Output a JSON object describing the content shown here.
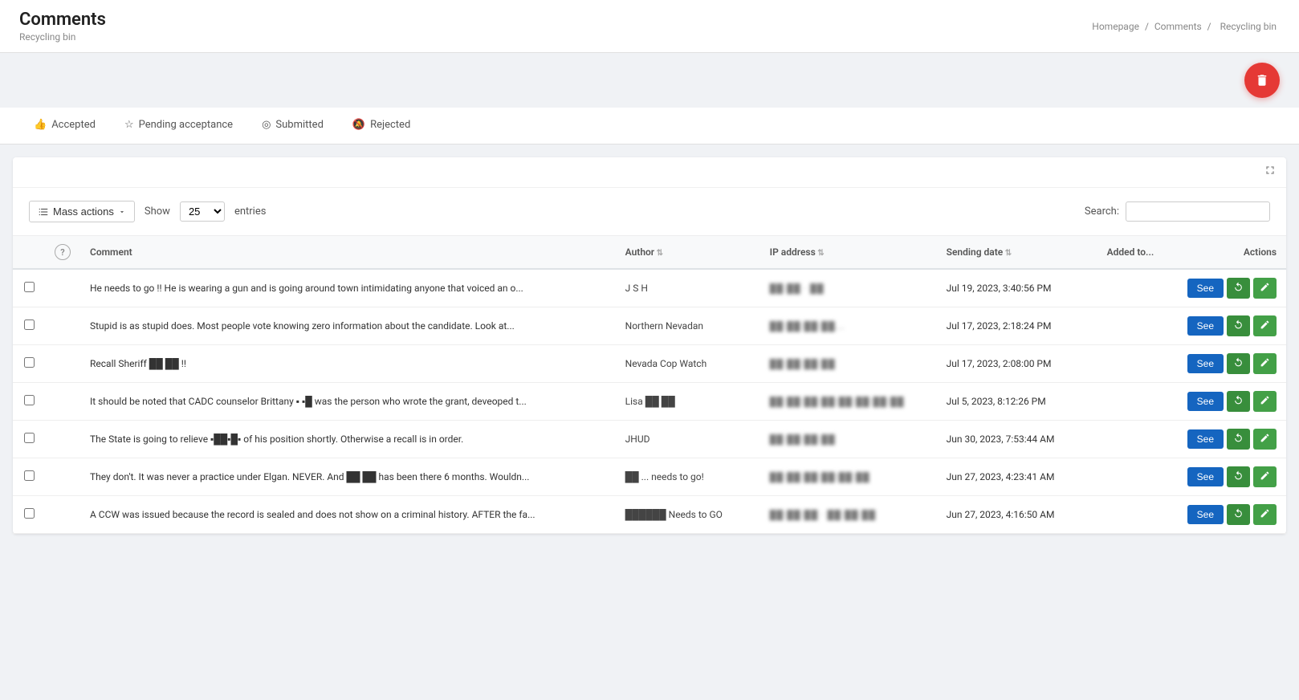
{
  "header": {
    "title": "Comments",
    "subtitle": "Recycling bin",
    "breadcrumb": [
      "Homepage",
      "Comments",
      "Recycling bin"
    ]
  },
  "tabs": [
    {
      "id": "accepted",
      "label": "Accepted",
      "icon": "👍",
      "active": false
    },
    {
      "id": "pending",
      "label": "Pending acceptance",
      "icon": "⭐",
      "active": false
    },
    {
      "id": "submitted",
      "label": "Submitted",
      "icon": "🔘",
      "active": false
    },
    {
      "id": "rejected",
      "label": "Rejected",
      "icon": "🔕",
      "active": false
    }
  ],
  "toolbar": {
    "mass_actions_label": "Mass actions",
    "show_label": "Show",
    "entries_label": "entries",
    "entries_value": "25",
    "search_label": "Search:",
    "search_placeholder": ""
  },
  "table": {
    "headers": [
      "",
      "",
      "Comment",
      "Author",
      "IP address",
      "Sending date",
      "Added to...",
      "Actions"
    ],
    "see_label": "See",
    "rows": [
      {
        "comment": "He needs to go !! He is wearing a gun and is going around town intimidating anyone that voiced an o...",
        "author": "J S H",
        "ip": "██·██ · ██",
        "date": "Jul 19, 2023, 3:40:56 PM",
        "added_to": ""
      },
      {
        "comment": "Stupid is as stupid does. Most people vote knowing zero information about the candidate. Look at...",
        "author": "Northern Nevadan",
        "ip": "██·██·██·██...",
        "date": "Jul 17, 2023, 2:18:24 PM",
        "added_to": ""
      },
      {
        "comment": "Recall Sheriff ██ ██ !!",
        "author": "Nevada Cop Watch",
        "ip": "██·██·██·██",
        "date": "Jul 17, 2023, 2:08:00 PM",
        "added_to": ""
      },
      {
        "comment": "It should be noted that CADC counselor Brittany ▪ ▪█ was the person who wrote the grant, deveoped t...",
        "author": "Lisa ██ ██",
        "ip": "██·██·██·██·██·██·██·██",
        "date": "Jul 5, 2023, 8:12:26 PM",
        "added_to": ""
      },
      {
        "comment": "The State is going to relieve ▪██▪█▪ of his position shortly. Otherwise a recall is in order.",
        "author": "JHUD",
        "ip": "██·██·██·██",
        "date": "Jun 30, 2023, 7:53:44 AM",
        "added_to": ""
      },
      {
        "comment": "They don't. It was never a practice under Elgan. NEVER. And ██ ██ has been there 6 months. Wouldn...",
        "author": "██ ... needs to go!",
        "ip": "██·██·██·██·██·██",
        "date": "Jun 27, 2023, 4:23:41 AM",
        "added_to": ""
      },
      {
        "comment": "A CCW was issued because the record is sealed and does not show on a criminal history. AFTER the fa...",
        "author": "██████ Needs to GO",
        "ip": "██·██·██ · ██·██·██",
        "date": "Jun 27, 2023, 4:16:50 AM",
        "added_to": ""
      }
    ]
  },
  "colors": {
    "accent_blue": "#1565c0",
    "accent_green": "#388e3c",
    "fab_red": "#e53935",
    "tab_active": "#1a73e8"
  }
}
